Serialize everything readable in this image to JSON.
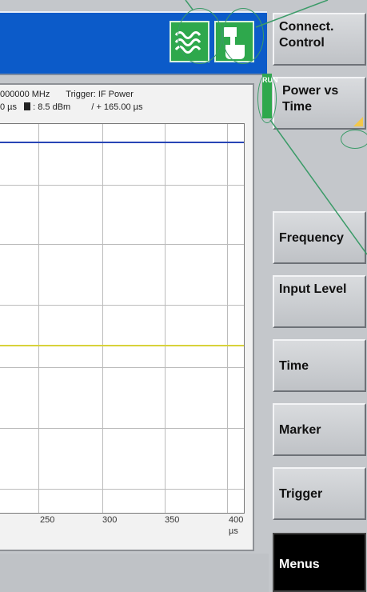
{
  "colors": {
    "title_bar": "#0c5bc9",
    "status_green": "#2ea84c",
    "callout": "#3b9b68",
    "trace_blue": "#2846b6",
    "trace_yellow": "#d8d23a"
  },
  "plot": {
    "frequency_text": "000000 MHz",
    "trigger_text": "Trigger: IF Power",
    "time_text": "0 µs",
    "marker_value_text": ": 8.5 dBm",
    "offset_text": "/ + 165.00 µs",
    "x_ticks": [
      "250",
      "300",
      "350",
      "400"
    ],
    "x_unit": "µs"
  },
  "run_indicator": "RUN",
  "softkeys": {
    "connect_control": "Connect. Control",
    "power_vs_time": "Power vs Time",
    "frequency": "Frequency",
    "input_level": "Input Level",
    "time": "Time",
    "marker": "Marker",
    "trigger": "Trigger",
    "menus": "Menus"
  },
  "icons": {
    "signal": "rf-signal-icon",
    "remote": "hand-touch-icon"
  }
}
